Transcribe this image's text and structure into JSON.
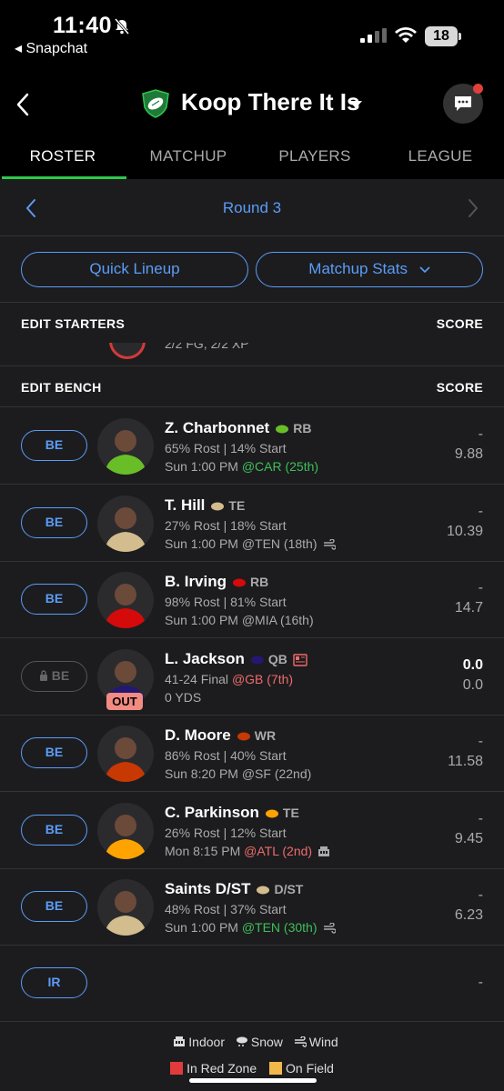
{
  "status_bar": {
    "time": "11:40",
    "back_app": "◂ Snapchat",
    "battery": "18"
  },
  "header": {
    "team_name": "Koop There It Is"
  },
  "tabs": [
    {
      "label": "ROSTER",
      "active": true
    },
    {
      "label": "MATCHUP",
      "active": false
    },
    {
      "label": "PLAYERS",
      "active": false
    },
    {
      "label": "LEAGUE",
      "active": false
    }
  ],
  "round": {
    "label": "Round 3"
  },
  "buttons": {
    "quick_lineup": "Quick Lineup",
    "matchup_stats": "Matchup Stats"
  },
  "starters": {
    "heading": "EDIT STARTERS",
    "score_heading": "SCORE",
    "peek_text": "2/2 FG, 2/2 XP"
  },
  "bench": {
    "heading": "EDIT BENCH",
    "score_heading": "SCORE",
    "players": [
      {
        "slot": "BE",
        "name": "Z. Charbonnet",
        "pos": "RB",
        "team_color": "#69be28",
        "line1": "65% Rost | 14% Start",
        "game": "Sun 1:00 PM",
        "opp": "@CAR (25th)",
        "opp_style": "good",
        "weather": "",
        "proj": "-",
        "score": "9.88",
        "locked": false,
        "out": false
      },
      {
        "slot": "BE",
        "name": "T. Hill",
        "pos": "TE",
        "team_color": "#d3bc8d",
        "line1": "27% Rost | 18% Start",
        "game": "Sun 1:00 PM",
        "opp": "@TEN (18th)",
        "opp_style": "plain",
        "weather": "wind",
        "proj": "-",
        "score": "10.39",
        "locked": false,
        "out": false
      },
      {
        "slot": "BE",
        "name": "B. Irving",
        "pos": "RB",
        "team_color": "#d50a0a",
        "line1": "98% Rost | 81% Start",
        "game": "Sun 1:00 PM",
        "opp": "@MIA (16th)",
        "opp_style": "plain",
        "weather": "",
        "proj": "-",
        "score": "14.7",
        "locked": false,
        "out": false
      },
      {
        "slot": "BE",
        "name": "L. Jackson",
        "pos": "QB",
        "team_color": "#241773",
        "line1": "41-24 Final",
        "game": "0 YDS",
        "opp": "@GB (7th)",
        "opp_style": "bad",
        "weather": "",
        "proj": "0.0",
        "score": "0.0",
        "locked": true,
        "out": true,
        "out_label": "OUT"
      },
      {
        "slot": "BE",
        "name": "D. Moore",
        "pos": "WR",
        "team_color": "#c83803",
        "line1": "86% Rost | 40% Start",
        "game": "Sun 8:20 PM",
        "opp": "@SF (22nd)",
        "opp_style": "plain",
        "weather": "",
        "proj": "-",
        "score": "11.58",
        "locked": false,
        "out": false
      },
      {
        "slot": "BE",
        "name": "C. Parkinson",
        "pos": "TE",
        "team_color": "#ffa300",
        "line1": "26% Rost | 12% Start",
        "game": "Mon 8:15 PM",
        "opp": "@ATL (2nd)",
        "opp_style": "bad",
        "weather": "indoor",
        "proj": "-",
        "score": "9.45",
        "locked": false,
        "out": false
      },
      {
        "slot": "BE",
        "name": "Saints D/ST",
        "pos": "D/ST",
        "team_color": "#d3bc8d",
        "line1": "48% Rost | 37% Start",
        "game": "Sun 1:00 PM",
        "opp": "@TEN (30th)",
        "opp_style": "good",
        "weather": "wind",
        "proj": "-",
        "score": "6.23",
        "locked": false,
        "out": false
      }
    ],
    "ir": {
      "slot": "IR",
      "score": "-"
    }
  },
  "legend": {
    "indoor": "Indoor",
    "snow": "Snow",
    "wind": "Wind",
    "red_zone": "In Red Zone",
    "on_field": "On Field"
  },
  "colors": {
    "accent": "#5b9cf7",
    "tab_active": "#2ec84a",
    "background": "#1c1c1e"
  }
}
